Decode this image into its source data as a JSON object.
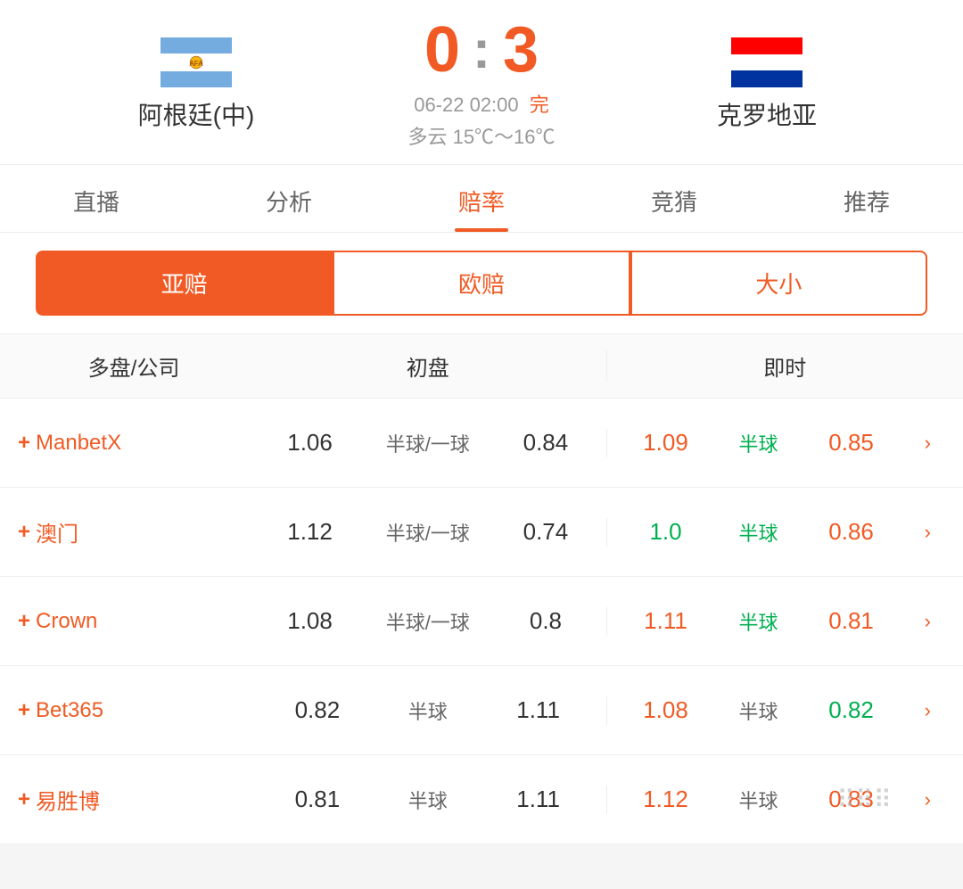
{
  "header": {
    "team_home": {
      "name": "阿根廷(中)",
      "flag_type": "arg"
    },
    "score_home": "0",
    "score_away": "3",
    "colon": ":",
    "team_away": {
      "name": "克罗地亚",
      "flag_type": "cro"
    },
    "match_date": "06-22 02:00",
    "status": "完",
    "weather": "多云  15℃～16℃"
  },
  "tabs": [
    {
      "label": "直播",
      "active": false
    },
    {
      "label": "分析",
      "active": false
    },
    {
      "label": "赔率",
      "active": true
    },
    {
      "label": "竞猜",
      "active": false
    },
    {
      "label": "推荐",
      "active": false
    }
  ],
  "sub_tabs": [
    {
      "label": "亚赔",
      "active": true
    },
    {
      "label": "欧赔",
      "active": false
    },
    {
      "label": "大小",
      "active": false
    }
  ],
  "table_header": {
    "col1": "多盘/公司",
    "col2": "初盘",
    "col3": "即时"
  },
  "rows": [
    {
      "company": "ManbetX",
      "initial": {
        "home": "1.06",
        "handicap": "半球/一球",
        "away": "0.84"
      },
      "realtime": {
        "home": "1.09",
        "home_color": "orange",
        "handicap": "半球",
        "handicap_color": "green",
        "away": "0.85",
        "away_color": "orange"
      }
    },
    {
      "company": "澳门",
      "initial": {
        "home": "1.12",
        "handicap": "半球/一球",
        "away": "0.74"
      },
      "realtime": {
        "home": "1.0",
        "home_color": "green",
        "handicap": "半球",
        "handicap_color": "green",
        "away": "0.86",
        "away_color": "orange"
      }
    },
    {
      "company": "Crown",
      "initial": {
        "home": "1.08",
        "handicap": "半球/一球",
        "away": "0.8"
      },
      "realtime": {
        "home": "1.11",
        "home_color": "orange",
        "handicap": "半球",
        "handicap_color": "green",
        "away": "0.81",
        "away_color": "orange"
      }
    },
    {
      "company": "Bet365",
      "initial": {
        "home": "0.82",
        "handicap": "半球",
        "away": "1.11"
      },
      "realtime": {
        "home": "1.08",
        "home_color": "orange",
        "handicap": "半球",
        "handicap_color": "default",
        "away": "0.82",
        "away_color": "green"
      }
    },
    {
      "company": "易胜博",
      "initial": {
        "home": "0.81",
        "handicap": "半球",
        "away": "1.11"
      },
      "realtime": {
        "home": "1.12",
        "home_color": "orange",
        "handicap": "半球",
        "handicap_color": "default",
        "away": "0.83",
        "away_color": "orange"
      },
      "has_watermark": true
    }
  ],
  "colors": {
    "orange": "#f15a24",
    "green": "#00b050",
    "default": "#666"
  }
}
